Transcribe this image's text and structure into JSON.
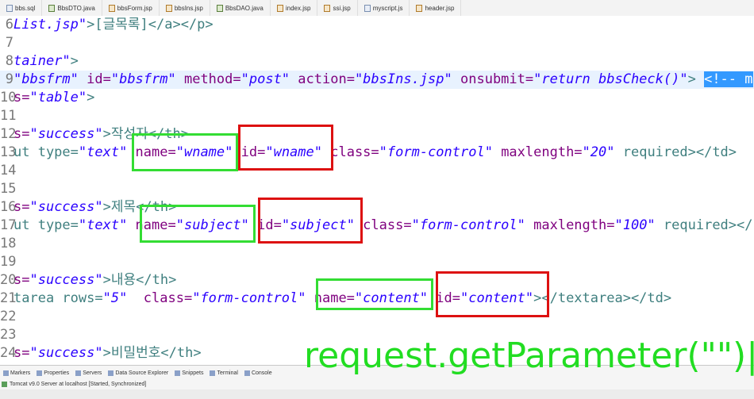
{
  "tabs": [
    "bbs.sql",
    "BbsDTO.java",
    "bbsForm.jsp",
    "bbsIns.jsp",
    "BbsDAO.java",
    "index.jsp",
    "ssi.jsp",
    "myscript.js",
    "header.jsp"
  ],
  "line_numbers": [
    "6",
    "7",
    "8",
    "9",
    "10",
    "11",
    "12",
    "13",
    "14",
    "15",
    "16",
    "17",
    "18",
    "19",
    "20",
    "21",
    "22",
    "23",
    "24"
  ],
  "code": {
    "l6_a": "List.jsp\"",
    "l6_b": ">[글목록]</a></p>",
    "l8_a": "tainer\"",
    "l8_b": ">",
    "l9_a": "\"bbsfrm\"",
    "l9_b": " id=",
    "l9_c": "\"bbsfrm\"",
    "l9_d": " method=",
    "l9_e": "\"post\"",
    "l9_f": " action=",
    "l9_g": "\"bbsIns.jsp\"",
    "l9_h": " onsubmit=",
    "l9_i": "\"return bbsCheck()\"",
    "l9_j": "> ",
    "l9_k": "<!-- m",
    "l10_a": "s=",
    "l10_b": "\"table\"",
    "l10_c": ">",
    "l12_a": "s=",
    "l12_b": "\"success\"",
    "l12_c": ">작성자</th>",
    "l13_a": "ut type=",
    "l13_b": "\"text\"",
    "l13_c": " name=",
    "l13_d": "\"wname\"",
    "l13_e": " id=",
    "l13_f": "\"wname\"",
    "l13_g": " class=",
    "l13_h": "\"form-control\"",
    "l13_i": " maxlength=",
    "l13_j": "\"20\"",
    "l13_k": " required></td>",
    "l16_a": "s=",
    "l16_b": "\"success\"",
    "l16_c": ">제목</th>",
    "l17_a": "ut type=",
    "l17_b": "\"text\"",
    "l17_c": " name=",
    "l17_d": "\"subject\"",
    "l17_e": " id=",
    "l17_f": "\"subject\"",
    "l17_g": " class=",
    "l17_h": "\"form-control\"",
    "l17_i": " maxlength=",
    "l17_j": "\"100\"",
    "l17_k": " required></",
    "l20_a": "s=",
    "l20_b": "\"success\"",
    "l20_c": ">내용</th>",
    "l21_a": "tarea rows=",
    "l21_b": "\"5\"",
    "l21_c": "  class=",
    "l21_d": "\"form-control\"",
    "l21_e": " name=",
    "l21_f": "\"content\"",
    "l21_g": " id=",
    "l21_h": "\"content\"",
    "l21_i": "></textarea></td>",
    "l24_a": "s=",
    "l24_b": "\"success\"",
    "l24_c": ">비밀번호</th>"
  },
  "panel": {
    "tabs": [
      "Markers",
      "Properties",
      "Servers",
      "Data Source Explorer",
      "Snippets",
      "Terminal",
      "Console"
    ],
    "server_status": "Tomcat v9.0 Server at localhost  [Started, Synchronized]"
  },
  "overlay_text": "request.getParameter(\"\")|",
  "colors": {
    "string": "#2a00ff",
    "attribute": "#7f007f",
    "tag": "#3f7f7f",
    "comment_selection": "#3399ff",
    "highlight_green": "#33dd33",
    "highlight_red": "#dd1111",
    "current_line": "#e8f2fe"
  }
}
